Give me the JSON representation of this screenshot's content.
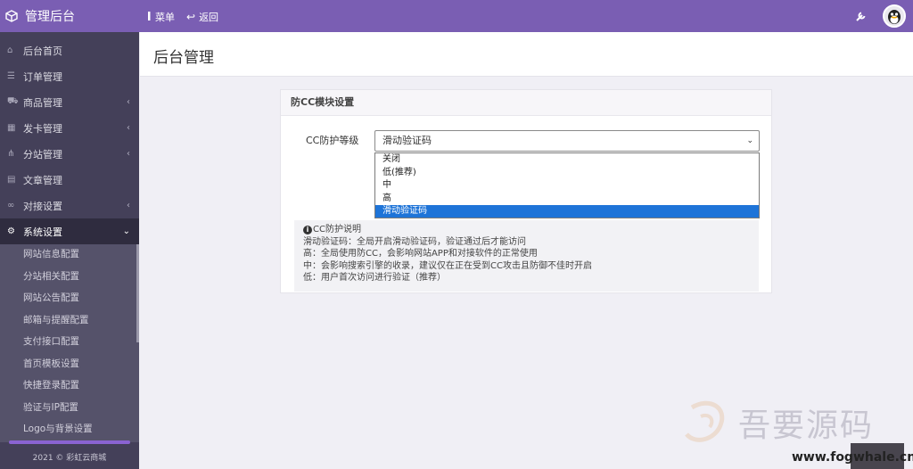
{
  "header": {
    "brand_title": "管理后台",
    "menu_label": "菜单",
    "back_label": "返回"
  },
  "sidebar": {
    "items": [
      {
        "label": "后台首页",
        "icon": "home-icon"
      },
      {
        "label": "订单管理",
        "icon": "list-icon"
      },
      {
        "label": "商品管理",
        "icon": "cart-icon"
      },
      {
        "label": "发卡管理",
        "icon": "grid-icon"
      },
      {
        "label": "分站管理",
        "icon": "sitemap-icon"
      },
      {
        "label": "文章管理",
        "icon": "book-icon"
      },
      {
        "label": "对接设置",
        "icon": "link-icon"
      },
      {
        "label": "系统设置",
        "icon": "gear-icon"
      }
    ],
    "submenu": [
      "网站信息配置",
      "分站相关配置",
      "网站公告配置",
      "邮箱与提醒配置",
      "支付接口配置",
      "首页模板设置",
      "快捷登录配置",
      "验证与IP配置",
      "Logo与背景设置"
    ],
    "footer": "2021 © 彩虹云商城"
  },
  "main": {
    "page_title": "后台管理",
    "card_title": "防CC模块设置",
    "field_label": "CC防护等级",
    "select_value": "滑动验证码",
    "options": [
      "关闭",
      "低(推荐)",
      "中",
      "高",
      "滑动验证码"
    ],
    "selected_option": "滑动验证码",
    "notice": {
      "title": "CC防护说明",
      "lines": [
        "滑动验证码：全局开启滑动验证码，验证通过后才能访问",
        "高：全局使用防CC，会影响网站APP和对接软件的正常使用",
        "中：会影响搜索引擎的收录，建议仅在正在受到CC攻击且防御不佳时开启",
        "低：用户首次访问进行验证（推荐）"
      ]
    }
  },
  "watermark": {
    "text": "吾要源码",
    "url": "www.fogwhale.cn"
  },
  "colors": {
    "topbar": "#7a5eb3",
    "sidebar": "#444059",
    "sidebar_active": "#2f2c3f",
    "selected_option": "#1e74d8"
  }
}
